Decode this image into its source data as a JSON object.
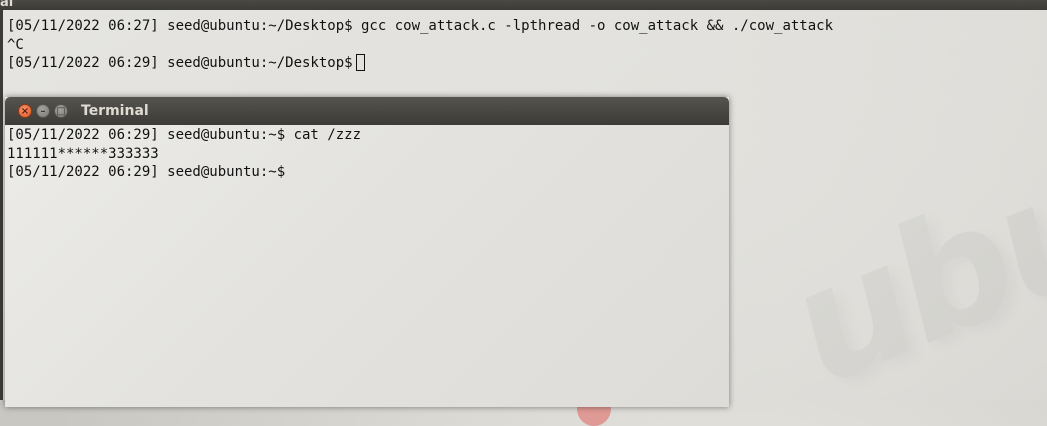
{
  "background_terminal": {
    "title_fragment": "al",
    "lines": [
      "[05/11/2022 06:27] seed@ubuntu:~/Desktop$ gcc cow_attack.c -lpthread -o cow_attack && ./cow_attack",
      "^C",
      "[05/11/2022 06:29] seed@ubuntu:~/Desktop$"
    ]
  },
  "foreground_terminal": {
    "title": "Terminal",
    "buttons": {
      "close": "×",
      "minimize": "–",
      "maximize": "□"
    },
    "lines": [
      "[05/11/2022 06:29] seed@ubuntu:~$ cat /zzz",
      "111111******333333",
      "[05/11/2022 06:29] seed@ubuntu:~$"
    ]
  },
  "wallpaper": {
    "text": "ubu"
  },
  "colors": {
    "titlebar": "#3c3b37",
    "close_button": "#e25a26",
    "terminal_bg": "#e9e8e4"
  }
}
